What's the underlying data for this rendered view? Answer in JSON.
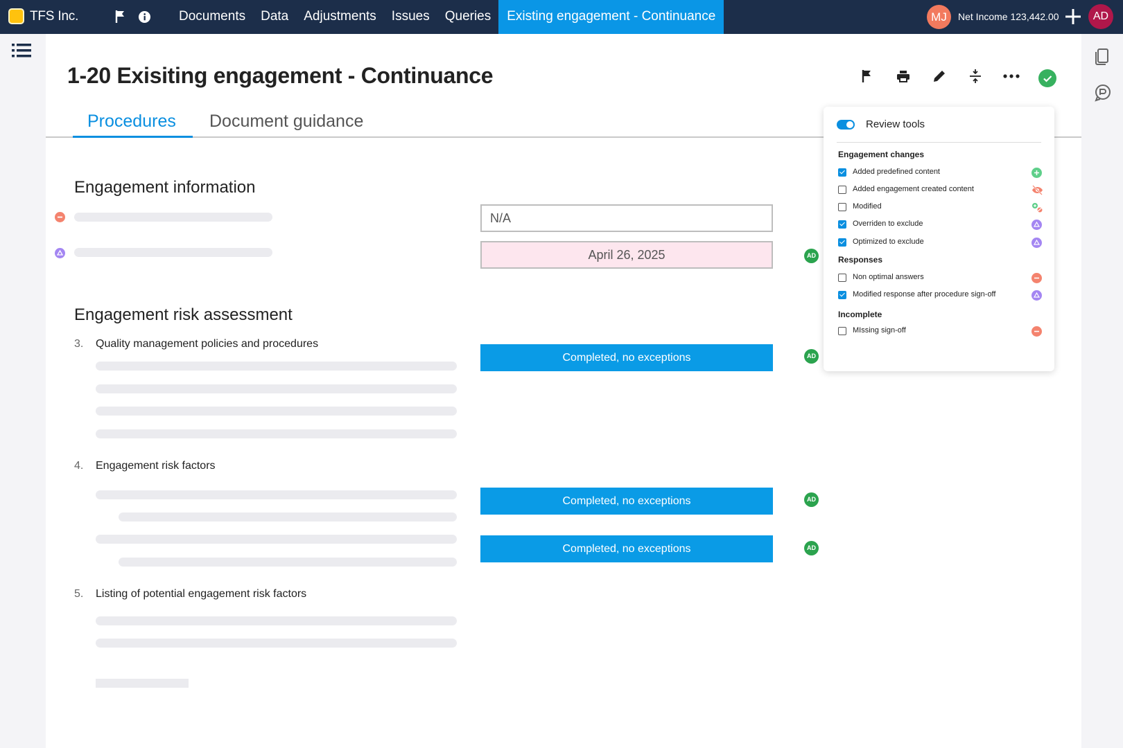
{
  "header": {
    "company": "TFS Inc.",
    "nav": [
      "Documents",
      "Data",
      "Adjustments",
      "Issues",
      "Queries"
    ],
    "active_tab": "Existing engagement - Continuance",
    "user_initials": "MJ",
    "net_income": "Net Income 123,442.00",
    "account_initials": "AD"
  },
  "page": {
    "title": "1-20 Exisiting engagement - Continuance",
    "tabs": [
      "Procedures",
      "Document guidance"
    ]
  },
  "engagement_info": {
    "heading": "Engagement information",
    "field_na": "N/A",
    "field_date": "April 26, 2025",
    "signoff_initials": "AD"
  },
  "risk_assessment": {
    "heading": "Engagement risk assessment",
    "procedures": [
      {
        "number": "3.",
        "title": "Quality management policies and procedures"
      },
      {
        "number": "4.",
        "title": "Engagement risk factors"
      },
      {
        "number": "5.",
        "title": "Listing of potential engagement risk factors"
      }
    ],
    "responses": [
      "Completed, no exceptions",
      "Completed, no exceptions",
      "Completed, no exceptions"
    ],
    "signoff_initials": [
      "AD",
      "AD",
      "AD"
    ]
  },
  "review_tools": {
    "title": "Review tools",
    "enabled": true,
    "groups": [
      {
        "name": "Engagement changes",
        "items": [
          {
            "label": "Added predefined content",
            "checked": true,
            "icon": "plus-circle-icon"
          },
          {
            "label": "Added engagement created content",
            "checked": false,
            "icon": "eye-slash-icon"
          },
          {
            "label": "Modified",
            "checked": false,
            "icon": "modified-icon"
          },
          {
            "label": "Overriden to exclude",
            "checked": true,
            "icon": "triangle-circle-icon"
          },
          {
            "label": "Optimized to exclude",
            "checked": true,
            "icon": "triangle-circle-icon"
          }
        ]
      },
      {
        "name": "Responses",
        "items": [
          {
            "label": "Non optimal answers",
            "checked": false,
            "icon": "minus-circle-icon"
          },
          {
            "label": "Modified response after procedure sign-off",
            "checked": true,
            "icon": "triangle-circle-icon"
          }
        ]
      },
      {
        "name": "Incomplete",
        "items": [
          {
            "label": "MIssing sign-off",
            "checked": false,
            "icon": "minus-circle-icon"
          }
        ]
      }
    ]
  },
  "colors": {
    "topbar": "#1c2e4a",
    "accent": "#0a96e6",
    "signoff_green": "#2ba34e",
    "date_highlight": "#fde6ee"
  }
}
